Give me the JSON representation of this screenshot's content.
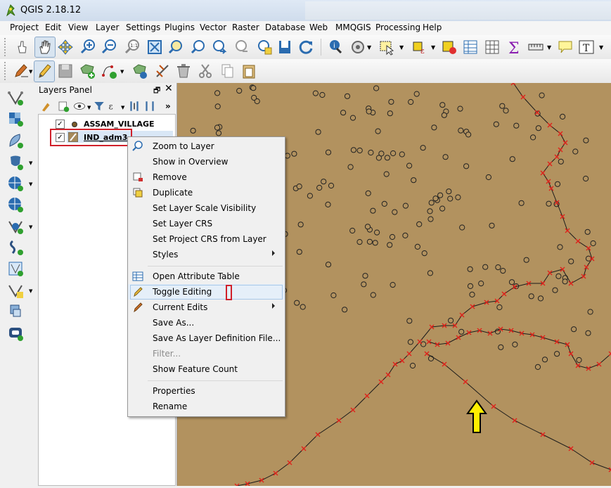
{
  "window": {
    "title": "QGIS 2.18.12"
  },
  "menubar": {
    "items": [
      "Project",
      "Edit",
      "View",
      "Layer",
      "Settings",
      "Plugins",
      "Vector",
      "Raster",
      "Database",
      "Web",
      "MMQGIS",
      "Processing",
      "Help"
    ]
  },
  "layers_panel": {
    "title": "Layers Panel",
    "layers": [
      {
        "name": "ASSAM_VILLAGE",
        "checked": true
      },
      {
        "name": "IND_adm3",
        "checked": true
      }
    ]
  },
  "context_menu": {
    "items": [
      {
        "label": "Zoom to Layer",
        "icon": "zoom-to-layer-icon",
        "submenu": false
      },
      {
        "label": "Show in Overview",
        "submenu": false
      },
      {
        "label": "Remove",
        "icon": "remove-layer-icon",
        "submenu": false
      },
      {
        "label": "Duplicate",
        "icon": "duplicate-layer-icon",
        "submenu": false
      },
      {
        "label": "Set Layer Scale Visibility",
        "submenu": false
      },
      {
        "label": "Set Layer CRS",
        "submenu": false
      },
      {
        "label": "Set Project CRS from Layer",
        "submenu": false
      },
      {
        "label": "Styles",
        "submenu": true
      },
      {
        "label": "Open Attribute Table",
        "icon": "attribute-table-icon",
        "submenu": false
      },
      {
        "label": "Toggle Editing",
        "icon": "pencil-icon",
        "submenu": false,
        "highlighted": true
      },
      {
        "label": "Current Edits",
        "icon": "current-edits-icon",
        "submenu": true
      },
      {
        "label": "Save As...",
        "submenu": false
      },
      {
        "label": "Save As Layer Definition File...",
        "submenu": false
      },
      {
        "label": "Filter...",
        "submenu": false,
        "disabled": true
      },
      {
        "label": "Show Feature Count",
        "submenu": false
      },
      {
        "label": "Properties",
        "submenu": false
      },
      {
        "label": "Rename",
        "submenu": false
      }
    ]
  },
  "colors": {
    "map_background": "#b2925f",
    "boundary_vertex": "#e0201a",
    "highlight_box": "#d0202a",
    "annotation_arrow": "#ffee00"
  }
}
